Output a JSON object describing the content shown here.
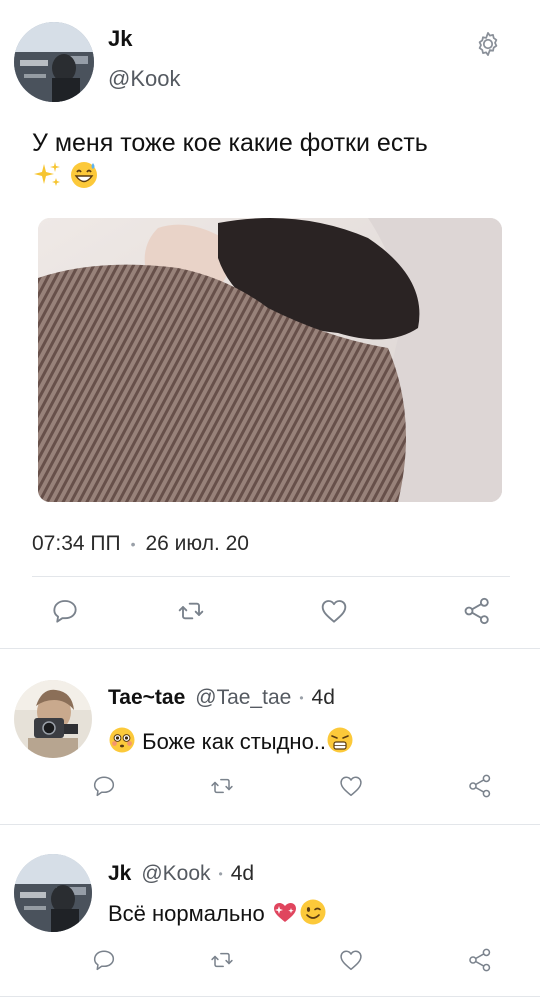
{
  "tweet": {
    "author_name": "Jk",
    "author_handle": "@Kook",
    "text_line1": "У меня тоже кое какие фотки есть",
    "text_emojis": [
      "sparkles-emoji",
      "grinning-sweat-emoji"
    ],
    "time": "07:34 ПП",
    "date": "26 июл. 20",
    "actions": [
      "reply-icon",
      "retweet-icon",
      "like-icon",
      "share-icon"
    ]
  },
  "replies": [
    {
      "name": "Tae~tae",
      "handle": "@Tae_tae",
      "time": "4d",
      "text": "Боже как стыдно..",
      "emojis": [
        "flushed-emoji",
        "weary-emoji"
      ]
    },
    {
      "name": "Jk",
      "handle": "@Kook",
      "time": "4d",
      "text": "Всё нормально",
      "emojis": [
        "heart-sparkle-emoji",
        "winking-emoji"
      ]
    }
  ],
  "colors": {
    "icon": "#7a828c",
    "divider": "#e3e6ea",
    "text": "#111111",
    "secondary": "#555a61"
  }
}
